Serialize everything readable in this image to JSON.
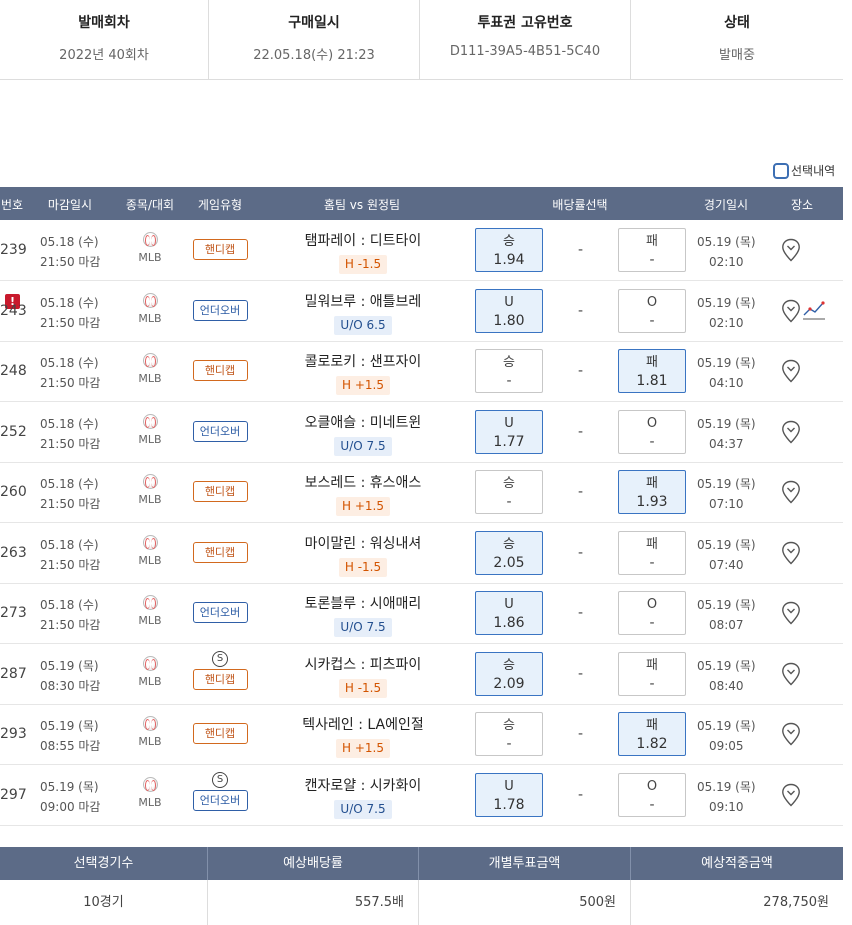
{
  "ticket_info": {
    "round_label": "발매회차",
    "round_value": "2022년 40회차",
    "purchase_label": "구매일시",
    "purchase_value": "22.05.18(수) 21:23",
    "serial_label": "투표권 고유번호",
    "serial_value": "D111-39A5-4B51-5C40",
    "status_label": "상태",
    "status_value": "발매중"
  },
  "selection_toggle_label": "선택내역",
  "columns": [
    "번호",
    "마감일시",
    "종목/대회",
    "게임유형",
    "홈팀 vs 원정팀",
    "배당률선택",
    "경기일시",
    "장소"
  ],
  "rows": [
    {
      "num": "239",
      "deadline_date": "05.18 (수)",
      "deadline_time": "21:50 마감",
      "league": "MLB",
      "special": "",
      "game_type": "핸디캡",
      "type": "hc",
      "match": "탬파레이 : 디트타이",
      "line": "H -1.5",
      "home_label": "승",
      "home_odds": "1.94",
      "home_sel": true,
      "draw": "-",
      "away_label": "패",
      "away_odds": "-",
      "away_sel": false,
      "game_date": "05.19 (목)",
      "game_time": "02:10",
      "alert": false,
      "trend": false
    },
    {
      "num": "243",
      "deadline_date": "05.18 (수)",
      "deadline_time": "21:50 마감",
      "league": "MLB",
      "special": "",
      "game_type": "언더오버",
      "type": "uo",
      "match": "밀워브루 : 애틀브레",
      "line": "U/O 6.5",
      "home_label": "U",
      "home_odds": "1.80",
      "home_sel": true,
      "draw": "-",
      "away_label": "O",
      "away_odds": "-",
      "away_sel": false,
      "game_date": "05.19 (목)",
      "game_time": "02:10",
      "alert": true,
      "trend": true
    },
    {
      "num": "248",
      "deadline_date": "05.18 (수)",
      "deadline_time": "21:50 마감",
      "league": "MLB",
      "special": "",
      "game_type": "핸디캡",
      "type": "hc",
      "match": "콜로로키 : 샌프자이",
      "line": "H +1.5",
      "home_label": "승",
      "home_odds": "-",
      "home_sel": false,
      "draw": "-",
      "away_label": "패",
      "away_odds": "1.81",
      "away_sel": true,
      "game_date": "05.19 (목)",
      "game_time": "04:10",
      "alert": false,
      "trend": false
    },
    {
      "num": "252",
      "deadline_date": "05.18 (수)",
      "deadline_time": "21:50 마감",
      "league": "MLB",
      "special": "",
      "game_type": "언더오버",
      "type": "uo",
      "match": "오클애슬 : 미네트윈",
      "line": "U/O 7.5",
      "home_label": "U",
      "home_odds": "1.77",
      "home_sel": true,
      "draw": "-",
      "away_label": "O",
      "away_odds": "-",
      "away_sel": false,
      "game_date": "05.19 (목)",
      "game_time": "04:37",
      "alert": false,
      "trend": false
    },
    {
      "num": "260",
      "deadline_date": "05.18 (수)",
      "deadline_time": "21:50 마감",
      "league": "MLB",
      "special": "",
      "game_type": "핸디캡",
      "type": "hc",
      "match": "보스레드 : 휴스애스",
      "line": "H +1.5",
      "home_label": "승",
      "home_odds": "-",
      "home_sel": false,
      "draw": "-",
      "away_label": "패",
      "away_odds": "1.93",
      "away_sel": true,
      "game_date": "05.19 (목)",
      "game_time": "07:10",
      "alert": false,
      "trend": false
    },
    {
      "num": "263",
      "deadline_date": "05.18 (수)",
      "deadline_time": "21:50 마감",
      "league": "MLB",
      "special": "",
      "game_type": "핸디캡",
      "type": "hc",
      "match": "마이말린 : 워싱내셔",
      "line": "H -1.5",
      "home_label": "승",
      "home_odds": "2.05",
      "home_sel": true,
      "draw": "-",
      "away_label": "패",
      "away_odds": "-",
      "away_sel": false,
      "game_date": "05.19 (목)",
      "game_time": "07:40",
      "alert": false,
      "trend": false
    },
    {
      "num": "273",
      "deadline_date": "05.18 (수)",
      "deadline_time": "21:50 마감",
      "league": "MLB",
      "special": "",
      "game_type": "언더오버",
      "type": "uo",
      "match": "토론블루 : 시애매리",
      "line": "U/O 7.5",
      "home_label": "U",
      "home_odds": "1.86",
      "home_sel": true,
      "draw": "-",
      "away_label": "O",
      "away_odds": "-",
      "away_sel": false,
      "game_date": "05.19 (목)",
      "game_time": "08:07",
      "alert": false,
      "trend": false
    },
    {
      "num": "287",
      "deadline_date": "05.19 (목)",
      "deadline_time": "08:30 마감",
      "league": "MLB",
      "special": "S",
      "game_type": "핸디캡",
      "type": "hc",
      "match": "시카컵스 : 피츠파이",
      "line": "H -1.5",
      "home_label": "승",
      "home_odds": "2.09",
      "home_sel": true,
      "draw": "-",
      "away_label": "패",
      "away_odds": "-",
      "away_sel": false,
      "game_date": "05.19 (목)",
      "game_time": "08:40",
      "alert": false,
      "trend": false
    },
    {
      "num": "293",
      "deadline_date": "05.19 (목)",
      "deadline_time": "08:55 마감",
      "league": "MLB",
      "special": "",
      "game_type": "핸디캡",
      "type": "hc",
      "match": "텍사레인 : LA에인절",
      "line": "H +1.5",
      "home_label": "승",
      "home_odds": "-",
      "home_sel": false,
      "draw": "-",
      "away_label": "패",
      "away_odds": "1.82",
      "away_sel": true,
      "game_date": "05.19 (목)",
      "game_time": "09:05",
      "alert": false,
      "trend": false
    },
    {
      "num": "297",
      "deadline_date": "05.19 (목)",
      "deadline_time": "09:00 마감",
      "league": "MLB",
      "special": "S",
      "game_type": "언더오버",
      "type": "uo",
      "match": "캔자로얄 : 시카화이",
      "line": "U/O 7.5",
      "home_label": "U",
      "home_odds": "1.78",
      "home_sel": true,
      "draw": "-",
      "away_label": "O",
      "away_odds": "-",
      "away_sel": false,
      "game_date": "05.19 (목)",
      "game_time": "09:10",
      "alert": false,
      "trend": false
    }
  ],
  "summary": {
    "headers": [
      "선택경기수",
      "예상배당률",
      "개별투표금액",
      "예상적중금액"
    ],
    "values": [
      "10경기",
      "557.5배",
      "500원",
      "278,750원"
    ]
  }
}
